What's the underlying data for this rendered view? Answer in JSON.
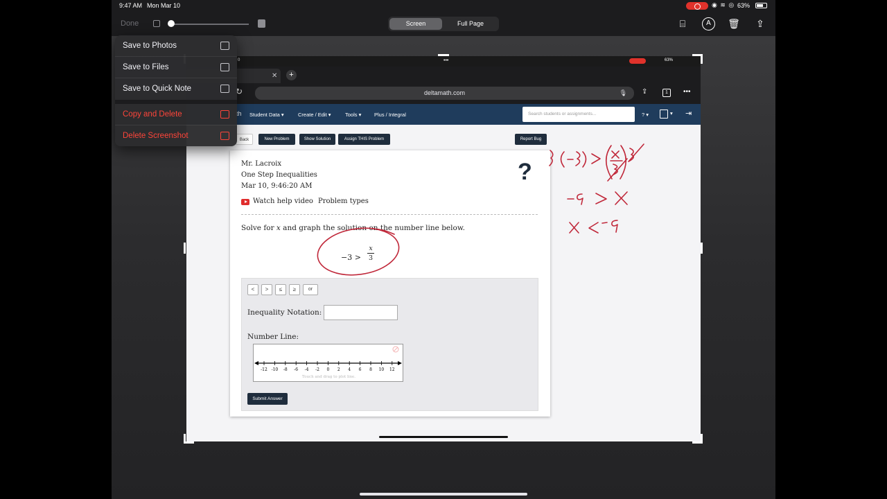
{
  "status": {
    "time": "9:47 AM",
    "date": "Mon Mar 10",
    "battery": "63%"
  },
  "toolbar": {
    "done_label": "Done",
    "segments": [
      "Screen",
      "Full Page"
    ],
    "selected_segment": "Screen"
  },
  "menu": {
    "items": [
      {
        "label": "Save to Photos",
        "icon": "save-photos-icon"
      },
      {
        "label": "Save to Files",
        "icon": "folder-icon"
      },
      {
        "label": "Save to Quick Note",
        "icon": "quick-note-icon"
      },
      {
        "label": "Copy and Delete",
        "icon": "copy-trash-icon",
        "destructive": true
      },
      {
        "label": "Delete Screenshot",
        "icon": "trash-icon",
        "destructive": true
      }
    ]
  },
  "inner_status": {
    "time": "0",
    "battery": "63%"
  },
  "browser": {
    "url": "deltamath.com",
    "tab_count": "1"
  },
  "deltamath_nav": {
    "logo_partial": "th",
    "items": [
      "Student Data ▾",
      "Create / Edit ▾",
      "Tools ▾",
      "Plus / Integral"
    ],
    "search_placeholder": "Search students or assignments...",
    "help": "? ▾"
  },
  "actions": {
    "back": "Back",
    "new_problem": "New Problem",
    "show_solution": "Show Solution",
    "assign": "Assign THIS Problem",
    "report_bug": "Report Bug"
  },
  "problem": {
    "teacher": "Mr. Lacroix",
    "assignment": "One Step Inequalities",
    "timestamp": "Mar 10, 9:46:20 AM",
    "help_video": "Watch help video",
    "problem_types": "Problem types",
    "prompt": "Solve for 𝑥 and graph the solution on the number line below.",
    "expression_lhs": "−3 >",
    "fraction_num": "x",
    "fraction_den": "3"
  },
  "answer": {
    "symbols": [
      "<",
      ">",
      "≤",
      "≥",
      "or"
    ],
    "inequality_label": "Inequality Notation:",
    "number_line_label": "Number Line:",
    "number_line_ticks": [
      "-12",
      "-10",
      "-8",
      "-6",
      "-4",
      "-2",
      "0",
      "2",
      "4",
      "6",
      "8",
      "10",
      "12"
    ],
    "number_line_hint": "Touch and drag to plot line.",
    "submit": "Submit Answer"
  },
  "colors": {
    "nav": "#1f3c5c",
    "ink": "#c0283a",
    "button": "#1f2d3d"
  }
}
